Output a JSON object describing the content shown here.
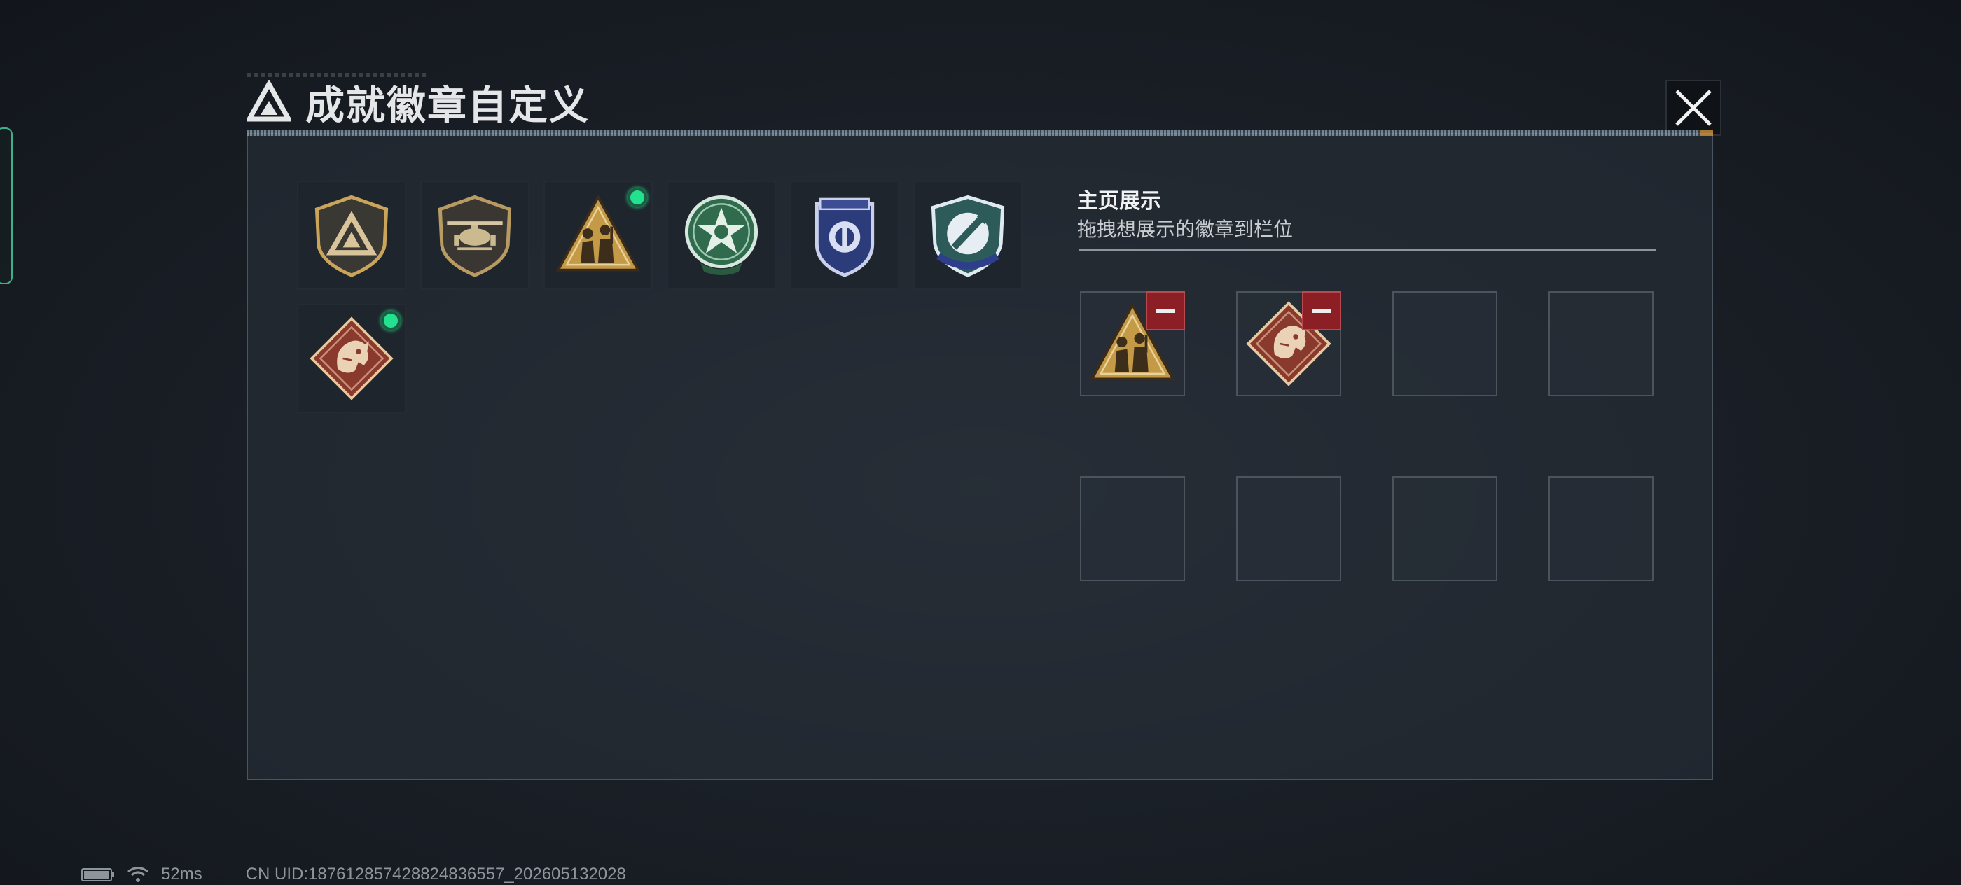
{
  "window": {
    "title": "成就徽章自定义"
  },
  "inventory": {
    "badges": [
      {
        "icon": "triangle-shield-badge-icon",
        "equipped": false
      },
      {
        "icon": "helicopter-badge-icon",
        "equipped": false
      },
      {
        "icon": "soldiers-triangle-badge-icon",
        "equipped": true
      },
      {
        "icon": "green-star-badge-icon",
        "equipped": false
      },
      {
        "icon": "blue-shield-badge-icon",
        "equipped": false
      },
      {
        "icon": "rocket-shield-badge-icon",
        "equipped": false
      },
      {
        "icon": "dragon-diamond-badge-icon",
        "equipped": true
      }
    ]
  },
  "display": {
    "title": "主页展示",
    "subtitle": "拖拽想展示的徽章到栏位",
    "slots": [
      {
        "badge": "soldiers-triangle-badge-icon"
      },
      {
        "badge": "dragon-diamond-badge-icon"
      },
      {
        "badge": null
      },
      {
        "badge": null
      },
      {
        "badge": null
      },
      {
        "badge": null
      },
      {
        "badge": null
      },
      {
        "badge": null
      }
    ]
  },
  "status": {
    "ping": "52ms",
    "uid": "CN UID:18761285742882483655​7_202605132028"
  },
  "colors": {
    "equipped_dot": "#22e28f",
    "remove_button": "#8b1f25",
    "gold": "#c9a45a"
  }
}
